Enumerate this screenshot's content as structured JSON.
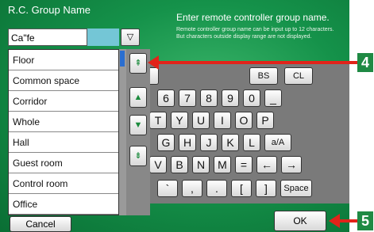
{
  "header": {
    "title": "R.C. Group Name",
    "input_value": "Ca\"fe",
    "dropdown_glyph": "▽"
  },
  "help": {
    "title": "Enter remote controller group name.",
    "text": "Remote controller group name can be input up to 12 characters. But characters outside display range are not displayed."
  },
  "list": {
    "items": [
      "Floor",
      "Common space",
      "Corridor",
      "Whole",
      "Hall",
      "Guest room",
      "Control room",
      "Office"
    ]
  },
  "scroll_buttons": {
    "page_up": "⇞",
    "up": "▲",
    "down": "▼",
    "page_down": "⇟"
  },
  "keyboard": {
    "row1": [
      "",
      "BS",
      "CL"
    ],
    "row2": [
      "6",
      "7",
      "8",
      "9",
      "0",
      "_"
    ],
    "row3": [
      "T",
      "Y",
      "U",
      "I",
      "O",
      "P"
    ],
    "row4": [
      "G",
      "H",
      "J",
      "K",
      "L",
      "a/A"
    ],
    "row5": [
      "V",
      "B",
      "N",
      "M",
      "=",
      "←",
      "→"
    ],
    "row6": [
      "`",
      ",",
      ".",
      "[",
      "]",
      "Space"
    ]
  },
  "footer": {
    "cancel": "Cancel",
    "ok": "OK"
  },
  "callouts": {
    "c4": "4",
    "c5": "5"
  },
  "colors": {
    "background": "#15924a",
    "arrow": "#e2231a",
    "callout": "#1f8a44",
    "cursor_block": "#74c6d6",
    "scroll_thumb": "#2a6ed0"
  }
}
